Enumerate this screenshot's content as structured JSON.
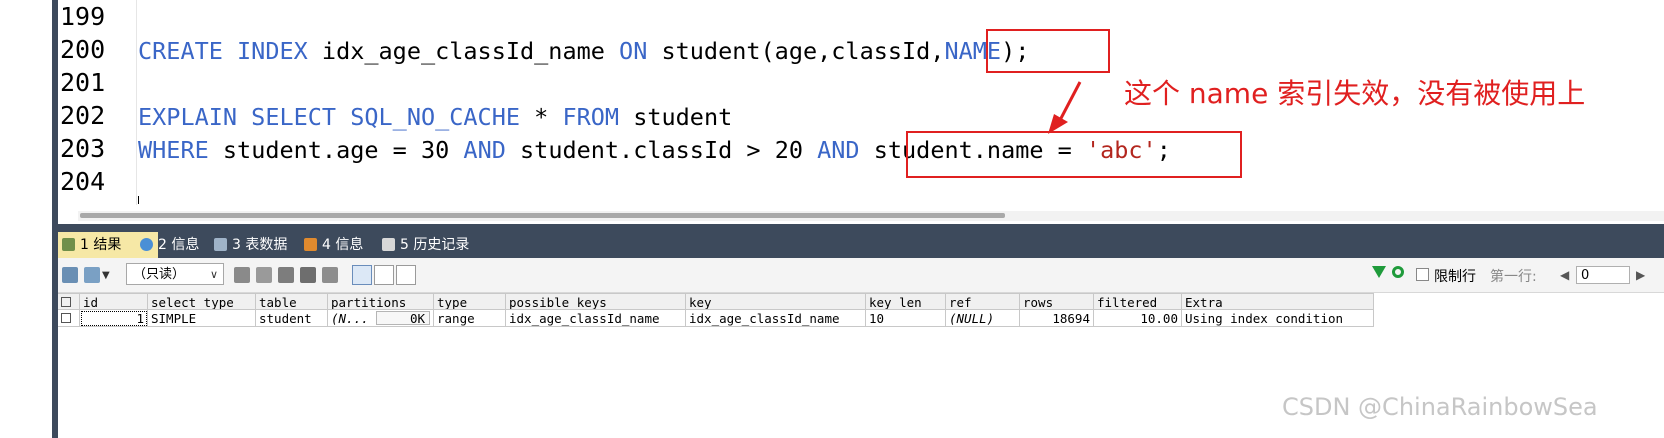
{
  "editor": {
    "line_numbers": [
      "199",
      "200",
      "201",
      "202",
      "203",
      "204"
    ],
    "line200": {
      "kw1": "CREATE INDEX",
      "t1": " idx_age_classId_name ",
      "kw2": "ON",
      "t2": " student(age,classId,",
      "boxed": "NAME",
      "t3": ");"
    },
    "line202": {
      "kw1": "EXPLAIN SELECT SQL_NO_CACHE",
      "t1": " * ",
      "kw2": "FROM",
      "t2": " student"
    },
    "line203": {
      "kw1": "WHERE",
      "t1": " student.age = 30 ",
      "kw2": "AND",
      "t2": " student.classId > 20 ",
      "kw3": "AND",
      "boxed_a": " student.name = ",
      "boxed_str": "'abc'",
      "boxed_b": ";"
    },
    "annotation": "这个 name 索引失效，没有被使用上"
  },
  "results": {
    "tabs": [
      {
        "label": "1 结果",
        "active": true
      },
      {
        "label": "2 信息",
        "active": false
      },
      {
        "label": "3 表数据",
        "active": false
      },
      {
        "label": "4 信息",
        "active": false
      },
      {
        "label": "5 历史记录",
        "active": false
      }
    ],
    "toolbar": {
      "readonly_select": "（只读）",
      "limit_label": "限制行",
      "first_row_label": "第一行:",
      "offset_value": "0"
    },
    "columns": [
      "id",
      "select_type",
      "table",
      "partitions",
      "type",
      "possible_keys",
      "key",
      "key_len",
      "ref",
      "rows",
      "filtered",
      "Extra"
    ],
    "rows": [
      {
        "id": "1",
        "select_type": "SIMPLE",
        "table": "student",
        "partitions": "(N...",
        "partitions_size": "0K",
        "type": "range",
        "possible_keys": "idx_age_classId_name",
        "key": "idx_age_classId_name",
        "key_len": "10",
        "ref": "(NULL)",
        "rows": "18694",
        "filtered": "10.00",
        "Extra": "Using index condition"
      }
    ]
  },
  "watermark": "CSDN @ChinaRainbowSea",
  "colors": {
    "keyword": "#3a66c7",
    "annotation": "#e02020",
    "panel": "#3d4a5c",
    "active_tab": "#f6e8a6"
  }
}
